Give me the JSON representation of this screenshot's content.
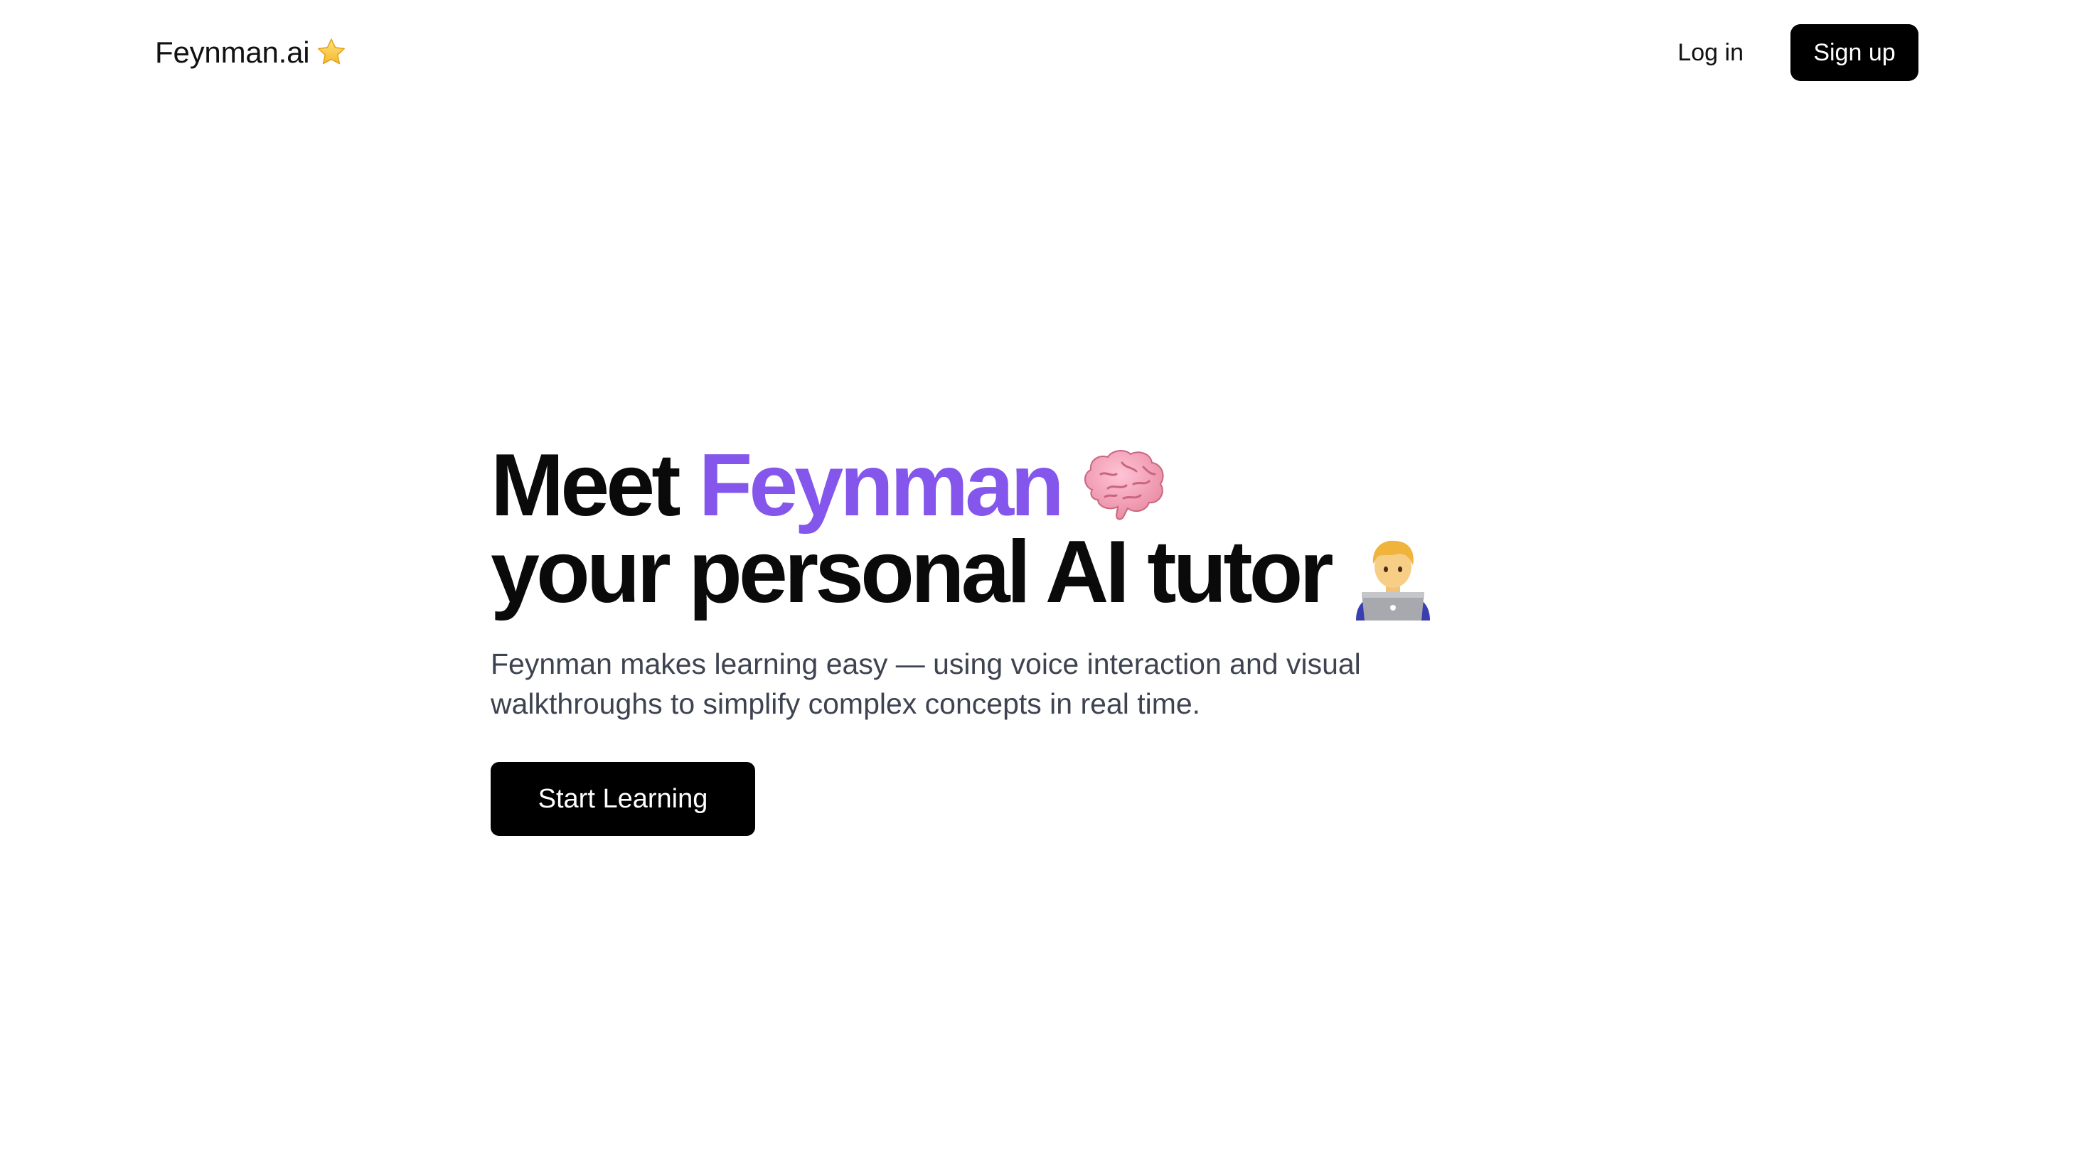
{
  "header": {
    "brand_name": "Feynman.ai",
    "brand_icon": "star-icon",
    "login_label": "Log in",
    "signup_label": "Sign up"
  },
  "hero": {
    "headline_part1": "Meet",
    "headline_accent": "Feynman",
    "headline_icon1": "brain-icon",
    "headline_line2": "your personal AI tutor",
    "headline_icon2": "technologist-icon",
    "subtitle": "Feynman makes learning easy — using voice interaction and visual walkthroughs to simplify complex concepts in real time.",
    "cta_label": "Start Learning"
  },
  "colors": {
    "accent": "#8456ec",
    "button_bg": "#000000",
    "text": "#0a0a0a",
    "subtitle_text": "#3d4350"
  }
}
